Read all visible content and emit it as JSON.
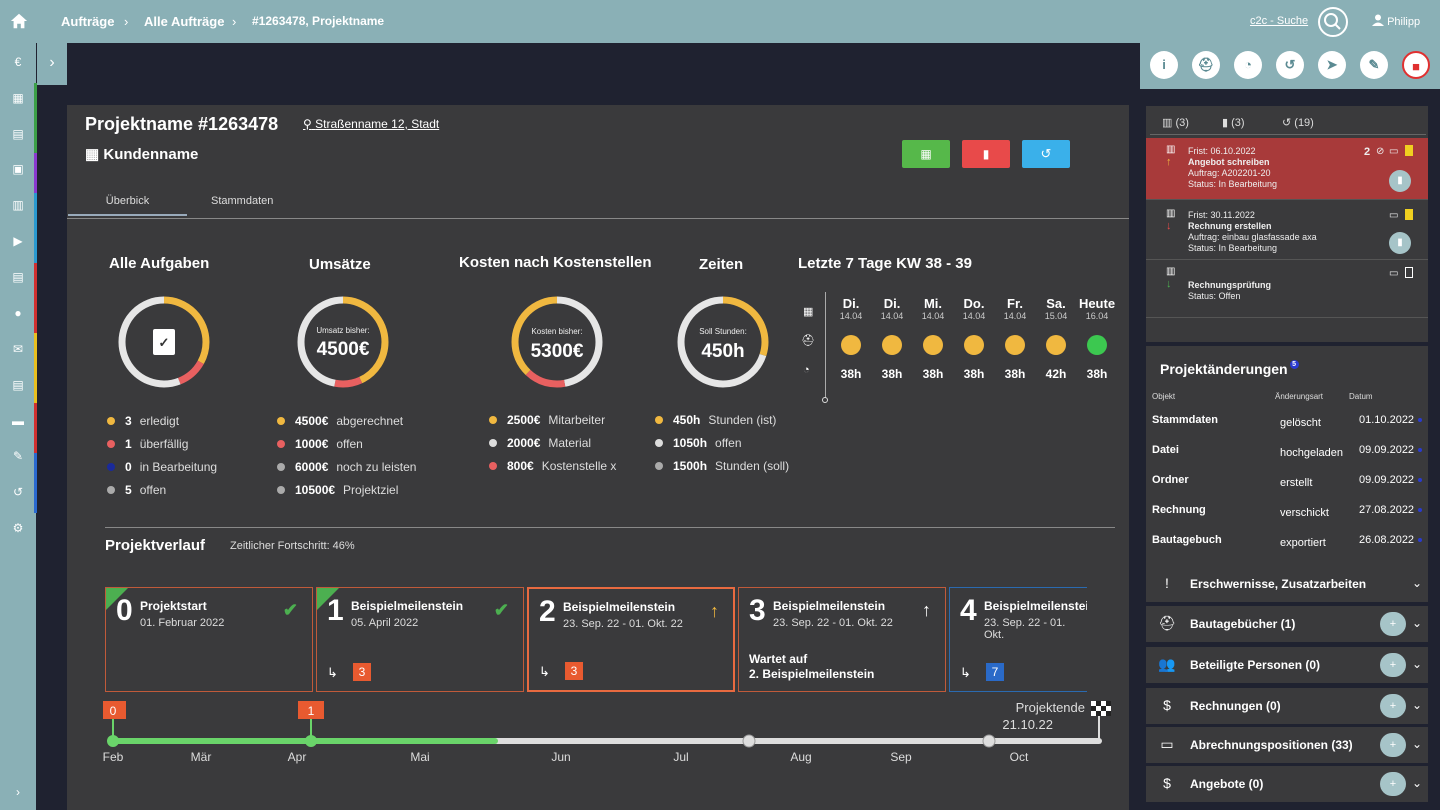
{
  "breadcrumb": {
    "items": [
      "Aufträge",
      "Alle Aufträge",
      "#1263478, Projektname"
    ]
  },
  "header": {
    "search_link": "c2c - Suche",
    "user": "Philipp"
  },
  "project": {
    "title": "Projektname #1263478",
    "address": "Straßenname 12, Stadt",
    "customer": "Kundenname"
  },
  "tabs": [
    "Überbick",
    "Stammdaten"
  ],
  "aufgaben": {
    "title": "Alle Aufgaben",
    "legend": [
      {
        "num": "3",
        "label": "erledigt",
        "color": "#f0b840"
      },
      {
        "num": "1",
        "label": "überfällig",
        "color": "#e86060"
      },
      {
        "num": "0",
        "label": "in Bearbeitung",
        "color": "#1a2a9a"
      },
      {
        "num": "5",
        "label": "offen",
        "color": "#aaaaaa"
      }
    ],
    "donut": [
      {
        "v": 0.33,
        "c": "#f0b840"
      },
      {
        "v": 0.11,
        "c": "#e86060"
      },
      {
        "v": 0.56,
        "c": "#e6e6e6"
      }
    ]
  },
  "umsaetze": {
    "title": "Umsätze",
    "center_label": "Umsatz bisher:",
    "center_value": "4500€",
    "legend": [
      {
        "num": "4500€",
        "label": "abgerechnet",
        "color": "#f0b840"
      },
      {
        "num": "1000€",
        "label": "offen",
        "color": "#e86060"
      },
      {
        "num": "6000€",
        "label": "noch zu leisten",
        "color": "#aaaaaa"
      },
      {
        "num": "10500€",
        "label": "Projektziel",
        "color": "#aaaaaa"
      }
    ],
    "donut": [
      {
        "v": 0.43,
        "c": "#f0b840"
      },
      {
        "v": 0.1,
        "c": "#e86060"
      },
      {
        "v": 0.47,
        "c": "#e6e6e6"
      }
    ]
  },
  "kosten": {
    "title": "Kosten nach Kostenstellen",
    "center_label": "Kosten bisher:",
    "center_value": "5300€",
    "legend": [
      {
        "num": "2500€",
        "label": "Mitarbeiter",
        "color": "#f0b840"
      },
      {
        "num": "2000€",
        "label": "Material",
        "color": "#dddddd"
      },
      {
        "num": "800€",
        "label": "Kostenstelle x",
        "color": "#e86060"
      }
    ],
    "donut": [
      {
        "v": 0.47,
        "c": "#e6e6e6"
      },
      {
        "v": 0.15,
        "c": "#e86060"
      },
      {
        "v": 0.38,
        "c": "#f0b840"
      }
    ]
  },
  "zeiten": {
    "title": "Zeiten",
    "center_label": "Soll Stunden:",
    "center_value": "450h",
    "legend": [
      {
        "num": "450h",
        "label": "Stunden (ist)",
        "color": "#f0b840"
      },
      {
        "num": "1050h",
        "label": "offen",
        "color": "#dddddd"
      },
      {
        "num": "1500h",
        "label": "Stunden (soll)",
        "color": "#aaaaaa"
      }
    ],
    "donut": [
      {
        "v": 0.3,
        "c": "#f0b840"
      },
      {
        "v": 0.7,
        "c": "#e6e6e6"
      }
    ]
  },
  "letzte7": {
    "title": "Letzte 7 Tage KW 38 - 39",
    "days": [
      {
        "name": "Di.",
        "date": "14.04",
        "hours": "38h",
        "color": "#f0b840"
      },
      {
        "name": "Di.",
        "date": "14.04",
        "hours": "38h",
        "color": "#f0b840"
      },
      {
        "name": "Mi.",
        "date": "14.04",
        "hours": "38h",
        "color": "#f0b840"
      },
      {
        "name": "Do.",
        "date": "14.04",
        "hours": "38h",
        "color": "#f0b840"
      },
      {
        "name": "Fr.",
        "date": "14.04",
        "hours": "38h",
        "color": "#f0b840"
      },
      {
        "name": "Sa.",
        "date": "15.04",
        "hours": "42h",
        "color": "#f0b840"
      },
      {
        "name": "Heute",
        "date": "16.04",
        "hours": "38h",
        "color": "#3cc850"
      }
    ]
  },
  "verlauf": {
    "title": "Projektverlauf",
    "progress_text": "Zeitlicher Fortschritt: 46%",
    "progress": 0.46,
    "milestones": [
      {
        "num": "0",
        "title": "Projektstart",
        "date": "01. Februar 2022",
        "status": "✔",
        "status_color": "#4caf50",
        "border": "#c05a3a",
        "done": true,
        "count": "",
        "count_color": "",
        "wait": ""
      },
      {
        "num": "1",
        "title": "Beispielmeilenstein",
        "date": "05. April 2022",
        "status": "✔",
        "status_color": "#4caf50",
        "border": "#c05a3a",
        "done": true,
        "count": "3",
        "count_color": "#e85a30",
        "wait": ""
      },
      {
        "num": "2",
        "title": "Beispielmeilenstein",
        "date": "23. Sep. 22 - 01. Okt. 22",
        "status": "↑",
        "status_color": "#f0b840",
        "border": "#e86a40",
        "done": false,
        "count": "3",
        "count_color": "#e85a30",
        "wait": ""
      },
      {
        "num": "3",
        "title": "Beispielmeilenstein",
        "date": "23. Sep. 22 - 01. Okt. 22",
        "status": "↑",
        "status_color": "#ffffff",
        "border": "#c05a3a",
        "done": false,
        "count": "",
        "count_color": "",
        "wait": "Wartet auf\n2. Beispielmeilenstein"
      },
      {
        "num": "4",
        "title": "Beispielmeilenstei",
        "date": "23. Sep. 22 - 01. Okt.",
        "status": "",
        "status_color": "",
        "border": "#2a6ab0",
        "done": false,
        "count": "7",
        "count_color": "#2a6ac8",
        "wait": ""
      }
    ],
    "months": [
      "Feb",
      "Mär",
      "Apr",
      "Mai",
      "Jun",
      "Jul",
      "Aug",
      "Sep",
      "Oct"
    ],
    "end_label": "Projektende",
    "end_date": "21.10.22",
    "markers": [
      "0",
      "1"
    ]
  },
  "tasks_tabs": [
    "(3)",
    "(3)",
    "(19)"
  ],
  "tasks": [
    {
      "deadline": "Frist: 06.10.2022",
      "title": "Angebot schreiben",
      "order": "Auftrag: A202201-20",
      "status": "Status: In Bearbeitung",
      "count": "2",
      "bg": "#a83a3a"
    },
    {
      "deadline": "Frist: 30.11.2022",
      "title": "Rechnung erstellen",
      "order": "Auftrag: einbau glasfassade axa",
      "status": "Status: In Bearbeitung",
      "count": "",
      "bg": "#3a3a3c"
    },
    {
      "deadline": "",
      "title": "Rechnungsprüfung",
      "order": "",
      "status": "Status: Offen",
      "count": "",
      "bg": "#3a3a3c"
    }
  ],
  "changes": {
    "title": "Projektänderungen",
    "badge": "5",
    "headers": [
      "Objekt",
      "Änderungsart",
      "Datum"
    ],
    "rows": [
      {
        "obj": "Stammdaten",
        "type": "gelöscht",
        "date": "01.10.2022"
      },
      {
        "obj": "Datei",
        "type": "hochgeladen",
        "date": "09.09.2022"
      },
      {
        "obj": "Ordner",
        "type": "erstellt",
        "date": "09.09.2022"
      },
      {
        "obj": "Rechnung",
        "type": "verschickt",
        "date": "27.08.2022"
      },
      {
        "obj": "Bautagebuch",
        "type": "exportiert",
        "date": "26.08.2022"
      }
    ]
  },
  "accordions": [
    {
      "label": "Erschwernisse, Zusatzarbeiten",
      "icon": "!",
      "plus": false
    },
    {
      "label": "Bautagebücher (1)",
      "icon": "⛑",
      "plus": true
    },
    {
      "label": "Beteiligte Personen (0)",
      "icon": "👥",
      "plus": true
    },
    {
      "label": "Rechnungen (0)",
      "icon": "$",
      "plus": true
    },
    {
      "label": "Abrechnungspositionen (33)",
      "icon": "▭",
      "plus": true
    },
    {
      "label": "Angebote (0)",
      "icon": "$",
      "plus": true
    }
  ],
  "colors": {
    "accent": "#8ab0b6",
    "panel": "#3a3a3c",
    "bg": "#1f2230",
    "green": "#6ad46a",
    "red": "#e85a30"
  }
}
